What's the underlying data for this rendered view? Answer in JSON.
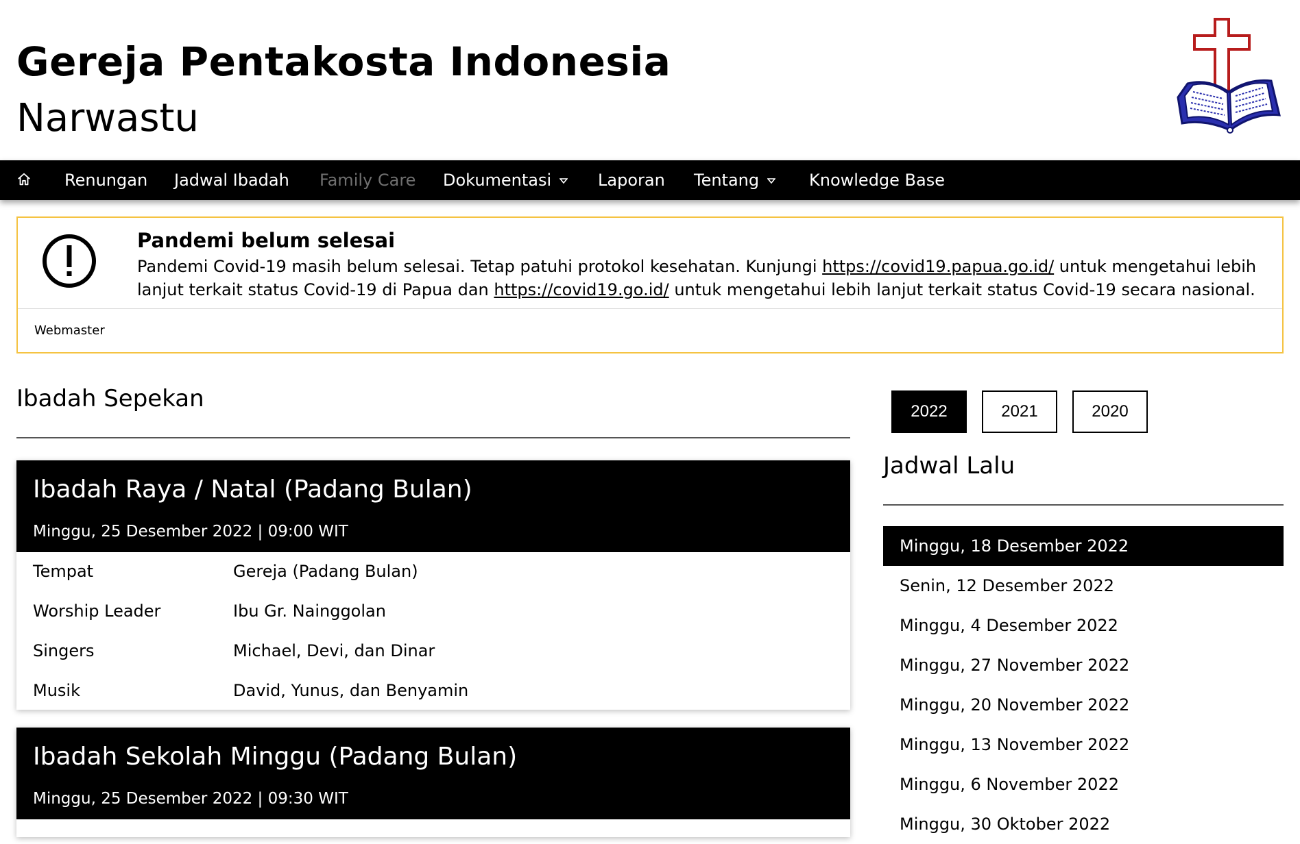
{
  "site": {
    "title": "Gereja Pentakosta Indonesia",
    "subtitle": "Narwastu",
    "logo_icon": "church-cross-bible-logo"
  },
  "nav": {
    "home_icon": "home-icon",
    "items": [
      {
        "label": "Renungan"
      },
      {
        "label": "Jadwal Ibadah"
      },
      {
        "label": "Family Care"
      },
      {
        "label": "Dokumentasi"
      },
      {
        "label": "Laporan"
      },
      {
        "label": "Tentang"
      },
      {
        "label": "Knowledge Base"
      }
    ]
  },
  "alert": {
    "icon": "exclamation-circle-icon",
    "title": "Pandemi belum selesai",
    "text1": "Pandemi Covid-19 masih belum selesai. Tetap patuhi protokol kesehatan. Kunjungi ",
    "link1": "https://covid19.papua.go.id/",
    "text2": " untuk mengetahui lebih lanjut terkait status Covid-19 di Papua dan ",
    "link2": "https://covid19.go.id/",
    "text3": " untuk mengetahui lebih lanjut terkait status Covid-19 secara nasional.",
    "footer": "Webmaster",
    "border_color": "#f5c342"
  },
  "weekly": {
    "title": "Ibadah Sepekan",
    "cards": [
      {
        "title": "Ibadah Raya / Natal (Padang Bulan)",
        "datetime": "Minggu, 25 Desember 2022 | 09:00 WIT",
        "rows": [
          {
            "key": "Tempat",
            "value": "Gereja (Padang Bulan)"
          },
          {
            "key": "Worship Leader",
            "value": "Ibu Gr. Nainggolan"
          },
          {
            "key": "Singers",
            "value": "Michael, Devi, dan Dinar"
          },
          {
            "key": "Musik",
            "value": "David, Yunus, dan Benyamin"
          }
        ]
      },
      {
        "title": "Ibadah Sekolah Minggu (Padang Bulan)",
        "datetime": "Minggu, 25 Desember 2022 | 09:30 WIT"
      }
    ]
  },
  "years": {
    "items": [
      "2022",
      "2021",
      "2020"
    ],
    "selected": "2022"
  },
  "past": {
    "title": "Jadwal Lalu",
    "items": [
      "Minggu, 18 Desember 2022",
      "Senin, 12 Desember 2022",
      "Minggu, 4 Desember 2022",
      "Minggu, 27 November 2022",
      "Minggu, 20 November 2022",
      "Minggu, 13 November 2022",
      "Minggu, 6 November 2022",
      "Minggu, 30 Oktober 2022"
    ],
    "selected_index": 0
  }
}
